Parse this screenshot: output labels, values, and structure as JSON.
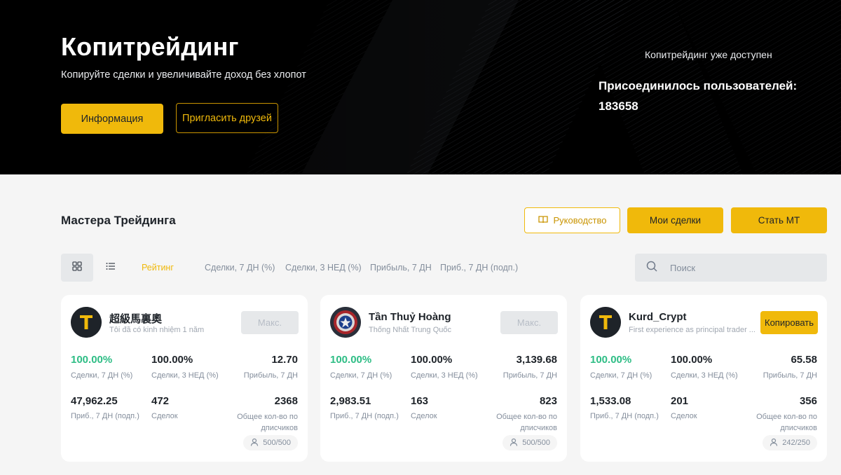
{
  "hero": {
    "title": "Копитрейдинг",
    "subtitle": "Копируйте сделки и увеличивайте доход без хлопот",
    "info_button": "Информация",
    "invite_button": "Пригласить друзей",
    "available_text": "Копитрейдинг уже доступен",
    "joined_label": "Присоединилось пользователей:",
    "joined_count": "183658"
  },
  "section": {
    "title": "Мастера Трейдинга",
    "guide_button": "Руководство",
    "my_trades_button": "Мои сделки",
    "become_button": "Стать МТ"
  },
  "toolbar": {
    "grid_icon": "grid-view-icon",
    "list_icon": "list-view-icon",
    "tabs": [
      "Рейтинг",
      "Сделки, 7 ДН (%)",
      "Сделки, 3 НЕД (%)",
      "Прибыль, 7 ДН",
      "Приб., 7 ДН (подп.)"
    ],
    "active_tab": "Рейтинг",
    "search_placeholder": "Поиск"
  },
  "cards": [
    {
      "name": "超級馬裏奧",
      "desc": "Tôi đã có kinh nhiệm 1 năm",
      "button": "Макс.",
      "avatar": "t-logo",
      "stats": {
        "win7d": "100.00%",
        "win7d_label": "Сделки, 7 ДН (%)",
        "win3w": "100.00%",
        "win3w_label": "Сделки, 3 НЕД (%)",
        "profit7d": "12.70",
        "profit7d_label": "Прибыль, 7 ДН",
        "subprofit": "47,962.25",
        "subprofit_label": "Приб., 7 ДН (подп.)",
        "trades": "472",
        "trades_label": "Сделок",
        "followers": "2368",
        "followers_label": "Общее кол-во по дписчиков",
        "slots": "500/500"
      }
    },
    {
      "name": "Tần Thuỷ Hoàng",
      "desc": "Thống Nhất Trung Quốc",
      "button": "Макс.",
      "avatar": "shield-avatar",
      "stats": {
        "win7d": "100.00%",
        "win7d_label": "Сделки, 7 ДН (%)",
        "win3w": "100.00%",
        "win3w_label": "Сделки, 3 НЕД (%)",
        "profit7d": "3,139.68",
        "profit7d_label": "Прибыль, 7 ДН",
        "subprofit": "2,983.51",
        "subprofit_label": "Приб., 7 ДН (подп.)",
        "trades": "163",
        "trades_label": "Сделок",
        "followers": "823",
        "followers_label": "Общее кол-во по дписчиков",
        "slots": "500/500"
      }
    },
    {
      "name": "Kurd_Crypt",
      "desc": "First experience as principal trader ...",
      "button": "Копировать",
      "avatar": "t-logo",
      "stats": {
        "win7d": "100.00%",
        "win7d_label": "Сделки, 7 ДН (%)",
        "win3w": "100.00%",
        "win3w_label": "Сделки, 3 НЕД (%)",
        "profit7d": "65.58",
        "profit7d_label": "Прибыль, 7 ДН",
        "subprofit": "1,533.08",
        "subprofit_label": "Приб., 7 ДН (подп.)",
        "trades": "201",
        "trades_label": "Сделок",
        "followers": "356",
        "followers_label": "Общее кол-во по дписчиков",
        "slots": "242/250"
      }
    }
  ],
  "colors": {
    "accent": "#f0b90b",
    "positive": "#2ebd85",
    "text": "#1e2329",
    "muted": "#848e9c"
  }
}
